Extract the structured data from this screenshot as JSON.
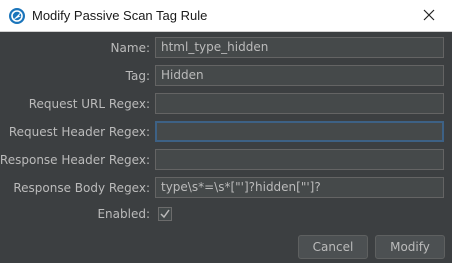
{
  "window": {
    "title": "Modify Passive Scan Tag Rule",
    "app_icon": "zap-logo-icon",
    "close_icon": "close-icon"
  },
  "form": {
    "name": {
      "label": "Name:",
      "value": "html_type_hidden"
    },
    "tag": {
      "label": "Tag:",
      "value": "Hidden"
    },
    "request_url_regex": {
      "label": "Request URL Regex:",
      "value": ""
    },
    "request_header_regex": {
      "label": "Request Header Regex:",
      "value": ""
    },
    "response_header_regex": {
      "label": "Response Header Regex:",
      "value": ""
    },
    "response_body_regex": {
      "label": "Response Body Regex:",
      "value": "type\\s*=\\s*[\"']?hidden[\"']?"
    },
    "enabled": {
      "label": "Enabled:",
      "checked": true
    }
  },
  "buttons": {
    "cancel": "Cancel",
    "modify": "Modify"
  },
  "colors": {
    "background": "#3c3f41",
    "field_bg": "#45494a",
    "text": "#bbbbbb",
    "focus_border": "#3d6185"
  }
}
